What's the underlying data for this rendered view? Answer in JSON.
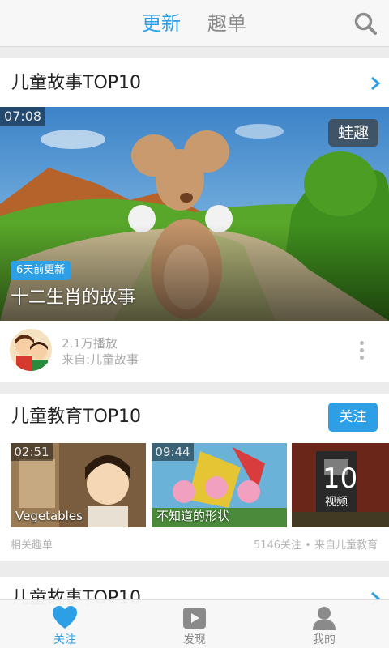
{
  "topbar": {
    "tab_active": "更新",
    "tab_inactive": "趣单"
  },
  "card1": {
    "title": "儿童故事TOP10",
    "video": {
      "duration": "07:08",
      "brand": "蛙趣",
      "badge": "6天前更新",
      "title": "十二生肖的故事"
    },
    "plays": "2.1万播放",
    "source": "来自:儿童故事"
  },
  "card2": {
    "title": "儿童教育TOP10",
    "follow_label": "关注",
    "thumbs": [
      {
        "duration": "02:51",
        "caption": "Vegetables"
      },
      {
        "duration": "09:44",
        "caption": "不知道的形状"
      },
      {
        "count": "10",
        "unit": "视频"
      }
    ],
    "related": "相关趣单",
    "meta": "5146关注 • 来自儿童教育"
  },
  "card3": {
    "title": "儿童故事TOP10"
  },
  "bottomnav": [
    {
      "label": "关注"
    },
    {
      "label": "发现"
    },
    {
      "label": "我的"
    }
  ],
  "colors": {
    "accent": "#2d9fe6",
    "bg": "#ececec",
    "card": "#ffffff"
  }
}
